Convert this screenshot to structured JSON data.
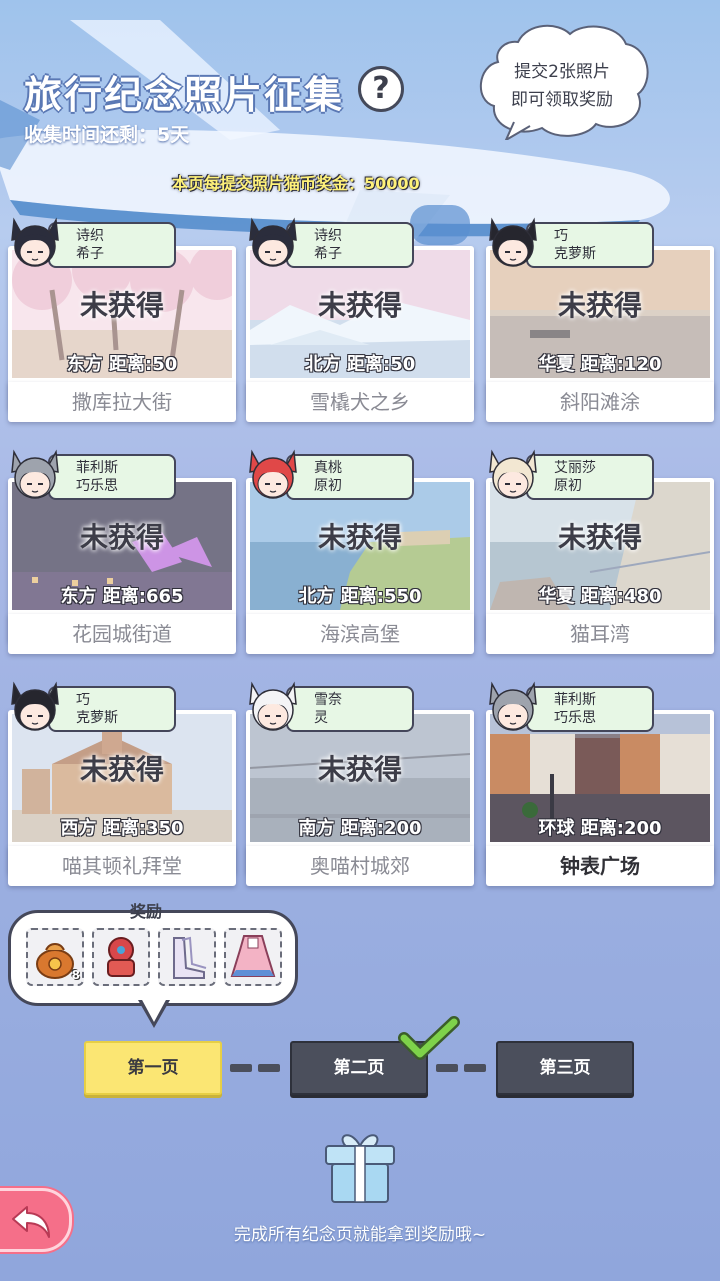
{
  "header": {
    "title": "旅行纪念照片征集",
    "help_symbol": "?",
    "remaining_time": "收集时间还剩：5天",
    "bubble_line1": "提交2张照片",
    "bubble_line2": "即可领取奖励",
    "bonus": "本页每提交照片猫币奖金：50000"
  },
  "cards": [
    {
      "char_line1": "诗织",
      "char_line2": "希子",
      "status": "未获得",
      "direction": "东方",
      "distance": "距离:50",
      "place": "撒库拉大街",
      "done": false,
      "hair": "#2b2d3c",
      "scene": "sakura"
    },
    {
      "char_line1": "诗织",
      "char_line2": "希子",
      "status": "未获得",
      "direction": "北方",
      "distance": "距离:50",
      "place": "雪橇犬之乡",
      "done": false,
      "hair": "#2b2d3c",
      "scene": "glacier"
    },
    {
      "char_line1": "巧",
      "char_line2": "克萝斯",
      "status": "未获得",
      "direction": "华夏",
      "distance": "距离:120",
      "place": "斜阳滩涂",
      "done": false,
      "hair": "#26262e",
      "scene": "sunset"
    },
    {
      "char_line1": "菲利斯",
      "char_line2": "巧乐思",
      "status": "未获得",
      "direction": "东方",
      "distance": "距离:665",
      "place": "花园城街道",
      "done": false,
      "hair": "#9ea3ad",
      "scene": "night"
    },
    {
      "char_line1": "真桃",
      "char_line2": "原初",
      "status": "未获得",
      "direction": "北方",
      "distance": "距离:550",
      "place": "海滨高堡",
      "done": false,
      "hair": "#e04848",
      "scene": "coast"
    },
    {
      "char_line1": "艾丽莎",
      "char_line2": "原初",
      "status": "未获得",
      "direction": "华夏",
      "distance": "距离:480",
      "place": "猫耳湾",
      "done": false,
      "hair": "#f2e7d2",
      "scene": "bay"
    },
    {
      "char_line1": "巧",
      "char_line2": "克萝斯",
      "status": "未获得",
      "direction": "西方",
      "distance": "距离:350",
      "place": "喵其顿礼拜堂",
      "done": false,
      "hair": "#26262e",
      "scene": "church"
    },
    {
      "char_line1": "雪奈",
      "char_line2": "灵",
      "status": "未获得",
      "direction": "南方",
      "distance": "距离:200",
      "place": "奥喵村城郊",
      "done": false,
      "hair": "#f4f4f6",
      "scene": "dusk"
    },
    {
      "char_line1": "菲利斯",
      "char_line2": "巧乐思",
      "status": "",
      "direction": "环球",
      "distance": "距离:200",
      "place": "钟表广场",
      "done": true,
      "hair": "#9ea3ad",
      "scene": "square"
    }
  ],
  "reward": {
    "label": "奖励",
    "items": [
      {
        "icon": "coin-bag-icon",
        "count": "8"
      },
      {
        "icon": "decoration-icon",
        "count": ""
      },
      {
        "icon": "boots-icon",
        "count": ""
      },
      {
        "icon": "outfit-icon",
        "count": ""
      }
    ]
  },
  "pages": [
    {
      "label": "第一页",
      "active": true
    },
    {
      "label": "第二页",
      "active": false
    },
    {
      "label": "第三页",
      "active": false
    }
  ],
  "footer": "完成所有纪念页就能拿到奖励哦~",
  "colors": {
    "active_page": "#fbe673",
    "inactive_page": "#4b4f5c",
    "tag_bg": "#e7f7e5",
    "back_button": "#f56f89",
    "check": "#7ed24a"
  }
}
